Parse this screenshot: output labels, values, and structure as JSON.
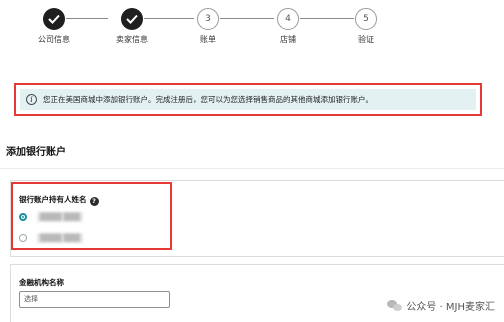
{
  "stepper": {
    "steps": [
      {
        "label": "公司信息",
        "status": "done",
        "number": "1"
      },
      {
        "label": "卖家信息",
        "status": "done",
        "number": "2"
      },
      {
        "label": "账单",
        "status": "todo",
        "number": "3"
      },
      {
        "label": "店铺",
        "status": "todo",
        "number": "4"
      },
      {
        "label": "验证",
        "status": "todo",
        "number": "5"
      }
    ]
  },
  "banner": {
    "icon": "info-icon",
    "text": "您正在美国商城中添加银行账户。完成注册后，您可以为您选择销售商品的其他商城添加银行账户。"
  },
  "section": {
    "title": "添加银行账户"
  },
  "account_holder": {
    "label": "银行账户持有人姓名",
    "help_icon": "?",
    "options": [
      {
        "text": "████ ███",
        "selected": true
      },
      {
        "text": "████ ███",
        "selected": false
      }
    ]
  },
  "institution": {
    "label": "金融机构名称",
    "select_value": "选择"
  },
  "watermark": {
    "text": "公众号 · MJH麦家汇"
  },
  "colors": {
    "highlight": "#e53935",
    "banner_bg": "#e3f1f3",
    "accent": "#1a8fa0",
    "done_step": "#1f1f1f"
  }
}
